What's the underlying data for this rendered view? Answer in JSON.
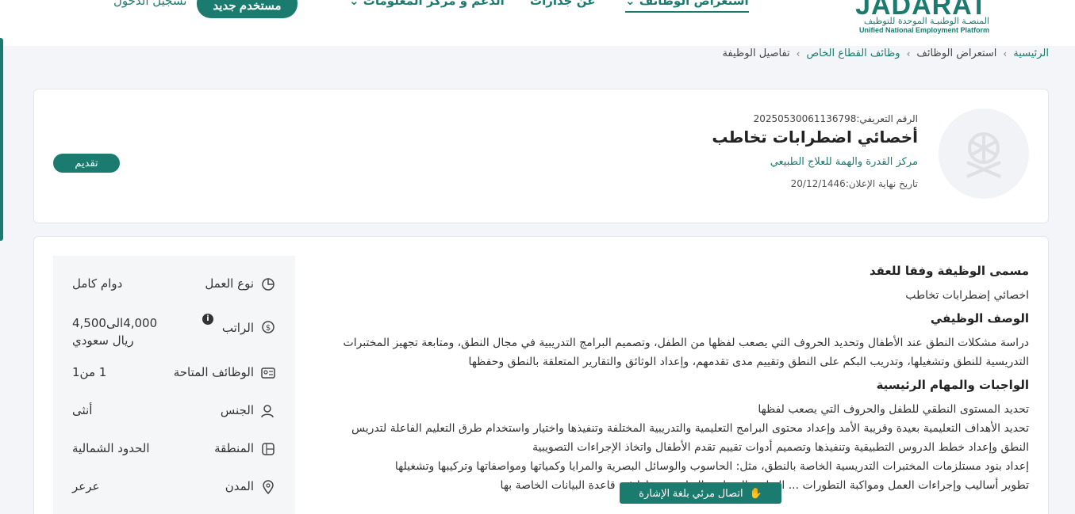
{
  "header": {
    "logo_text": "JADARAT",
    "logo_ar": "المنصـة الوطنيـة الموحدة للتوظيف",
    "logo_en": "Unified National Employment Platform",
    "nav": [
      {
        "label": "استعراض الوظائف"
      },
      {
        "label": "عن جدارات"
      },
      {
        "label": "الدعم و مركز المعلومات"
      }
    ],
    "register_label": "مستخدم جديد",
    "login_label": "تسجيل الدخول"
  },
  "breadcrumb": {
    "home": "الرئيسية",
    "jobs": "استعراض الوظائف",
    "private": "وظائف القطاع الخاص",
    "current": "تفاصيل الوظيفة",
    "sep": "›"
  },
  "job": {
    "id_text": "الرقم التعريفي:20250530061136798",
    "title": "أخصائي اضطرابات تخاطب",
    "company": "مركز القدرة والهمة للعلاج الطبيعي",
    "deadline_text": "تاريخ نهاية الإعلان:20/12/1446",
    "apply_label": "تقديم"
  },
  "details": [
    {
      "label": "نوع العمل",
      "value": "دوام كامل",
      "icon": "pie-chart-icon"
    },
    {
      "label": "الراتب",
      "value": "4,000الى4,500 ريال سعودي",
      "icon": "money-icon"
    },
    {
      "label": "الوظائف المتاحة",
      "value": "1 من1",
      "icon": "id-card-icon"
    },
    {
      "label": "الجنس",
      "value": "أنثى",
      "icon": "user-icon"
    },
    {
      "label": "المنطقة",
      "value": "الحدود الشمالية",
      "icon": "map-icon"
    },
    {
      "label": "المدن",
      "value": "عرعر",
      "icon": "location-icon"
    }
  ],
  "description": {
    "title_heading": "مسمى الوظيفة وفقا للعقد",
    "title_value": "اخصائي إضطرابات تخاطب",
    "desc_heading": "الوصف الوظيفي",
    "desc_value": "دراسة مشكلات النطق عند الأطفال وتحديد الحروف التي يصعب لفظها من الطفل، وتصميم البرامج التدريبية في مجال النطق، ومتابعة تجهيز المختبرات التدريسية للنطق وتشغيلها، وتدريب البكم على النطق وتقييم مدى تقدمهم، وإعداد الوثائق والتقارير المتعلقة بالنطق وحفظها",
    "duties_heading": "الواجبات والمهام الرئيسية",
    "duties": [
      "تحديد المستوى النطقي للطفل والحروف التي يصعب لفظها",
      "تحديد الأهداف التعليمية بعيدة وقريبة الأمد وإعداد محتوى البرامج التعليمية والتدريبية المختلفة وتنفيذها واختيار واستخدام طرق التعليم الفاعلة لتدريس النطق وإعداد خطط الدروس التطبيقية وتنفيذها وتصميم أدوات تقييم تقدم الأطفال واتخاذ الإجراءات التصويبية",
      "إعداد بنود مستلزمات المختبرات التدريسية الخاصة بالنطق، مثل: الحاسوب والوسائل البصرية والمرايا وكمياتها ومواصفاتها وتركيبها وتشغيلها",
      "تطوير أساليب وإجراءات العمل ومواكبة التطورات ... التقارير المتعلقة بالنطق وحفظها في قاعدة البيانات الخاصة بها"
    ]
  },
  "sign_language_label": "اتصال مرئي بلغة الإشارة"
}
